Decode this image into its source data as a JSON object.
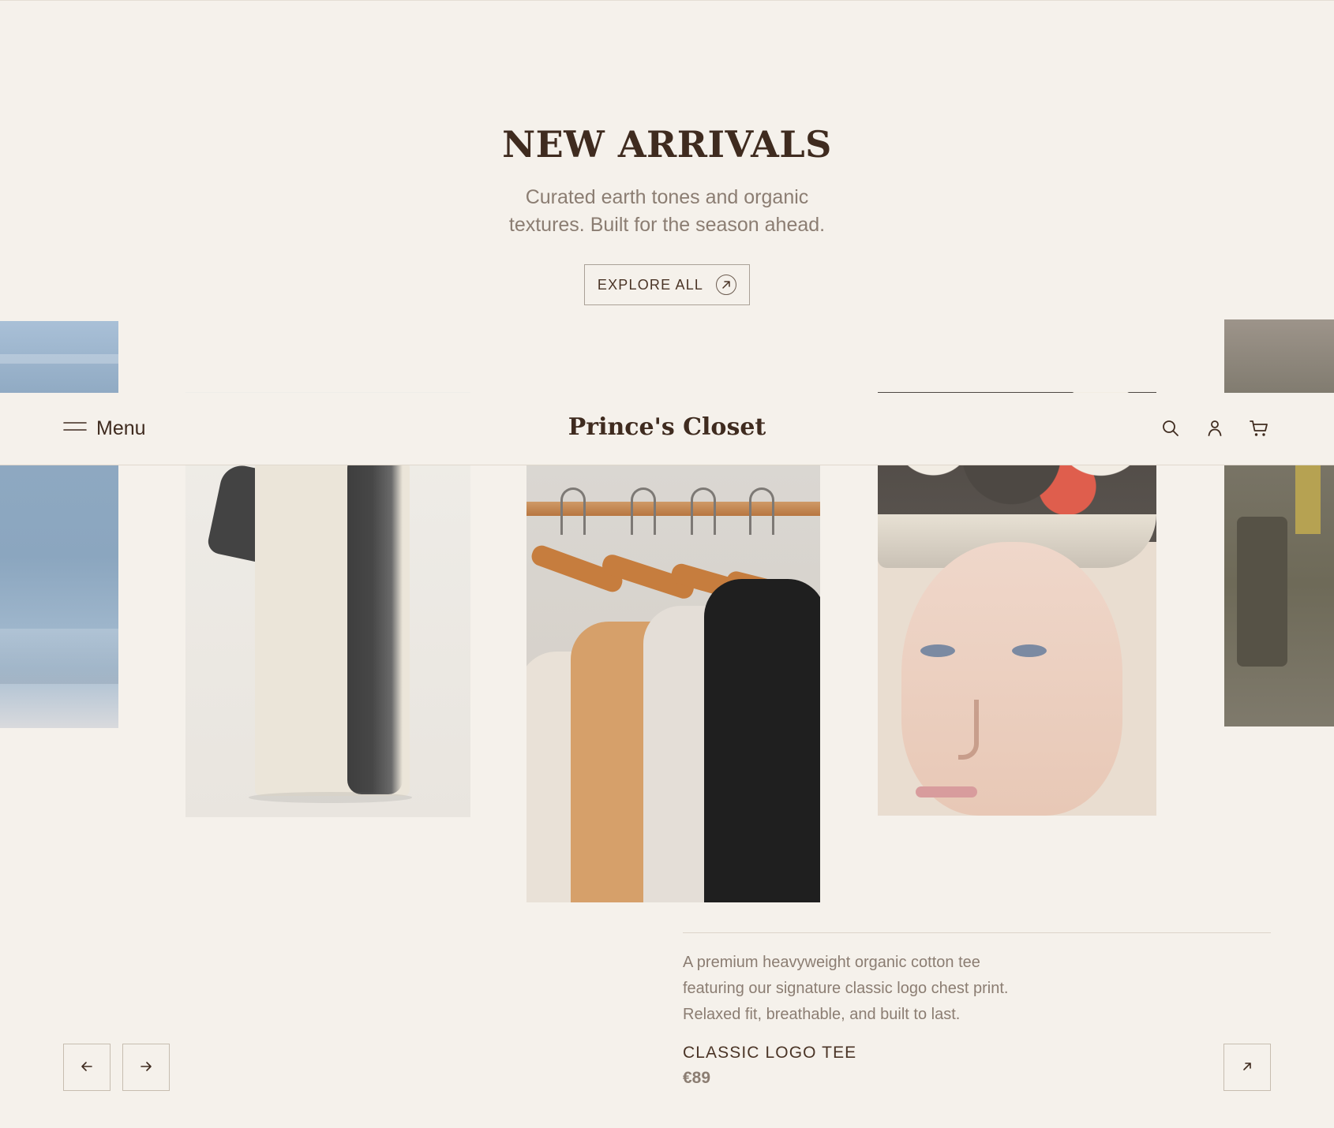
{
  "hero": {
    "title": "NEW ARRIVALS",
    "subtitle_lines": [
      "Curated earth tones and organic",
      "textures. Built for the season ahead."
    ],
    "cta": {
      "label": "EXPLORE ALL",
      "icon": "arrow-up-right-icon"
    }
  },
  "header": {
    "menu_label": "Menu",
    "menu_icon": "hamburger-menu-icon",
    "brand": "Prince's Closet",
    "icons": [
      "search-icon",
      "user-icon",
      "cart-icon"
    ]
  },
  "gallery": {
    "images": [
      "denim-jeans-photo",
      "black-white-tee-photo",
      "tshirts-on-hangers-photo",
      "model-camo-cap-photo",
      "street-style-photo"
    ]
  },
  "product": {
    "description_lines": [
      "A premium heavyweight organic cotton tee",
      "featuring our signature classic logo chest print.",
      "Relaxed fit, breathable, and built to last."
    ],
    "name": "CLASSIC LOGO TEE",
    "price": "€89",
    "link_icon": "arrow-up-right-icon"
  },
  "carousel": {
    "prev_icon": "arrow-left-icon",
    "next_icon": "arrow-right-icon"
  },
  "colors": {
    "background": "#f5f1eb",
    "text_primary": "#3f2b1f",
    "text_muted": "#8b7d72",
    "border": "#c7bdb0"
  }
}
